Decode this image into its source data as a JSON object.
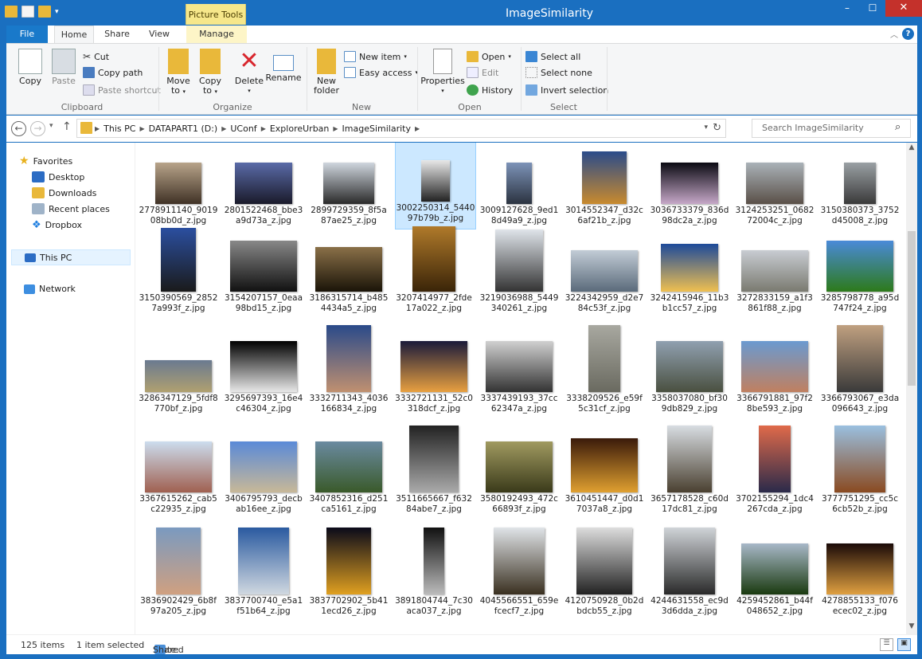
{
  "window": {
    "title": "ImageSimilarity",
    "context_tab": "Picture Tools",
    "minimize": "–",
    "maximize": "☐",
    "close": "✕"
  },
  "tabs": {
    "file": "File",
    "home": "Home",
    "share": "Share",
    "view": "View",
    "manage": "Manage"
  },
  "ribbon": {
    "clipboard": {
      "label": "Clipboard",
      "copy": "Copy",
      "paste": "Paste",
      "cut": "Cut",
      "copy_path": "Copy path",
      "paste_shortcut": "Paste shortcut"
    },
    "organize": {
      "label": "Organize",
      "move_to": "Move",
      "move_to2": "to",
      "copy_to": "Copy",
      "copy_to2": "to",
      "delete": "Delete",
      "rename": "Rename"
    },
    "new": {
      "label": "New",
      "new_folder": "New",
      "new_folder2": "folder",
      "new_item": "New item",
      "easy_access": "Easy access"
    },
    "open": {
      "label": "Open",
      "properties": "Properties",
      "open": "Open",
      "edit": "Edit",
      "history": "History"
    },
    "select": {
      "label": "Select",
      "select_all": "Select all",
      "select_none": "Select none",
      "invert_selection": "Invert selection"
    }
  },
  "address": {
    "crumbs": [
      "This PC",
      "DATAPART1 (D:)",
      "UConf",
      "ExploreUrban",
      "ImageSimilarity"
    ],
    "search_placeholder": "Search ImageSimilarity"
  },
  "nav": {
    "favorites": "Favorites",
    "desktop": "Desktop",
    "downloads": "Downloads",
    "recent_places": "Recent places",
    "dropbox": "Dropbox",
    "this_pc": "This PC",
    "network": "Network"
  },
  "files": [
    [
      "2778911140_901908bb0d_z.jpg",
      "2801522468_bbe3a9d73a_z.jpg",
      "2899729359_8f5a87ae25_z.jpg",
      "3002250314_544097b79b_z.jpg",
      "3009127628_9ed18d49a9_z.jpg",
      "3014552347_d32c6af21b_z.jpg",
      "3036733379_836d98dc2a_z.jpg",
      "3124253251_068272004c_z.jpg",
      "3150380373_3752d45008_z.jpg"
    ],
    [
      "3150390569_28527a993f_z.jpg",
      "3154207157_0eaa98bd15_z.jpg",
      "3186315714_b4854434a5_z.jpg",
      "3207414977_2fde17a022_z.jpg",
      "3219036988_5449340261_z.jpg",
      "3224342959_d2e784c53f_z.jpg",
      "3242415946_11b3b1cc57_z.jpg",
      "3272833159_a1f3861f88_z.jpg",
      "3285798778_a95d747f24_z.jpg"
    ],
    [
      "3286347129_5fdf8770bf_z.jpg",
      "3295697393_16e4c46304_z.jpg",
      "3332711343_4036166834_z.jpg",
      "3332721131_52c0318dcf_z.jpg",
      "3337439193_37cc62347a_z.jpg",
      "3338209526_e59f5c31cf_z.jpg",
      "3358037080_bf309db829_z.jpg",
      "3366791881_97f28be593_z.jpg",
      "3366793067_e3da096643_z.jpg"
    ],
    [
      "3367615262_cab5c22935_z.jpg",
      "3406795793_decbab16ee_z.jpg",
      "3407852316_d251ca5161_z.jpg",
      "3511665667_f63284abe7_z.jpg",
      "3580192493_472c66893f_z.jpg",
      "3610451447_d0d17037a8_z.jpg",
      "3657178528_c60d17dc81_z.jpg",
      "3702155294_1dc4267cda_z.jpg",
      "3777751295_cc5c6cb52b_z.jpg"
    ],
    [
      "3836902429_6b8f97a205_z.jpg",
      "3837700740_e5a1f51b64_z.jpg",
      "3837702902_5b411ecd26_z.jpg",
      "3891804744_7c30aca037_z.jpg",
      "4045566551_659efcecf7_z.jpg",
      "4120750928_0b2dbdcb55_z.jpg",
      "4244631558_ec9d3d6dda_z.jpg",
      "4259452861_b44f048652_z.jpg",
      "4278855133_f076ecec02_z.jpg"
    ]
  ],
  "selected_file": "3002250314_544097b79b_z.jpg",
  "status": {
    "items": "125 items",
    "selected": "1 item selected",
    "state_label": "State:",
    "state_value": "Shared"
  }
}
